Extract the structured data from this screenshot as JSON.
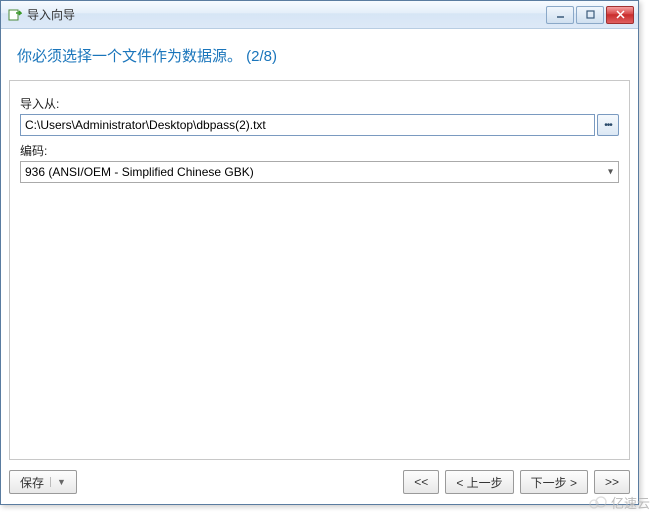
{
  "window": {
    "title": "导入向导"
  },
  "heading": "你必须选择一个文件作为数据源。 (2/8)",
  "fields": {
    "import_from_label": "导入从:",
    "import_from_value": "C:\\Users\\Administrator\\Desktop\\dbpass(2).txt",
    "encoding_label": "编码:",
    "encoding_value": "936 (ANSI/OEM - Simplified Chinese GBK)"
  },
  "buttons": {
    "save": "保存",
    "first": "<<",
    "prev": "< 上一步",
    "next": "下一步 >",
    "last": ">>"
  },
  "watermark": "亿速云"
}
